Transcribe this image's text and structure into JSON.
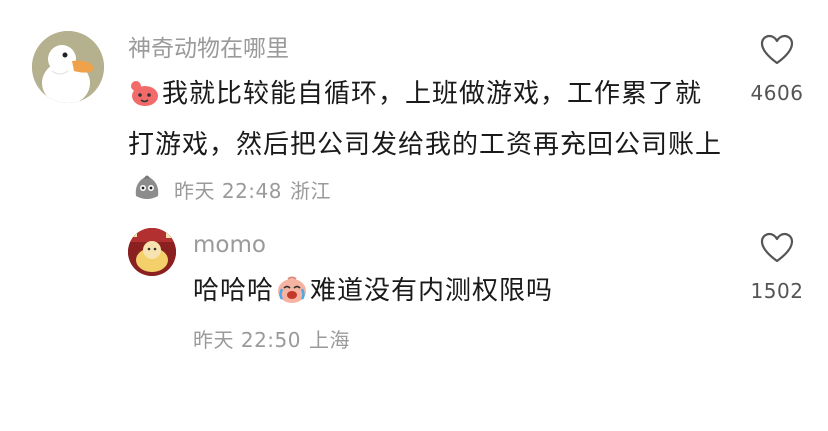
{
  "comments": [
    {
      "username": "神奇动物在哪里",
      "text_part1": "我就比较能自循环，上班做游戏，工作累了就打游戏，然后把公司发给我的工资再充回公司账上",
      "time": "昨天 22:48",
      "location": "浙江",
      "like_count": "4606",
      "reply": {
        "username": "momo",
        "text_before": "哈哈哈",
        "text_after": "难道没有内测权限吗",
        "time": "昨天 22:50",
        "location": "上海",
        "like_count": "1502"
      }
    }
  ],
  "icons": {
    "heart": "heart-outline-icon",
    "lead_emoji": "waving-emoji-icon",
    "tail_emoji": "grey-blob-emoji-icon",
    "cry_laugh_emoji": "laugh-cry-emoji-icon"
  },
  "colors": {
    "meta": "#9a9a9a",
    "text": "#1a1a1a",
    "heart_stroke": "#555555"
  }
}
